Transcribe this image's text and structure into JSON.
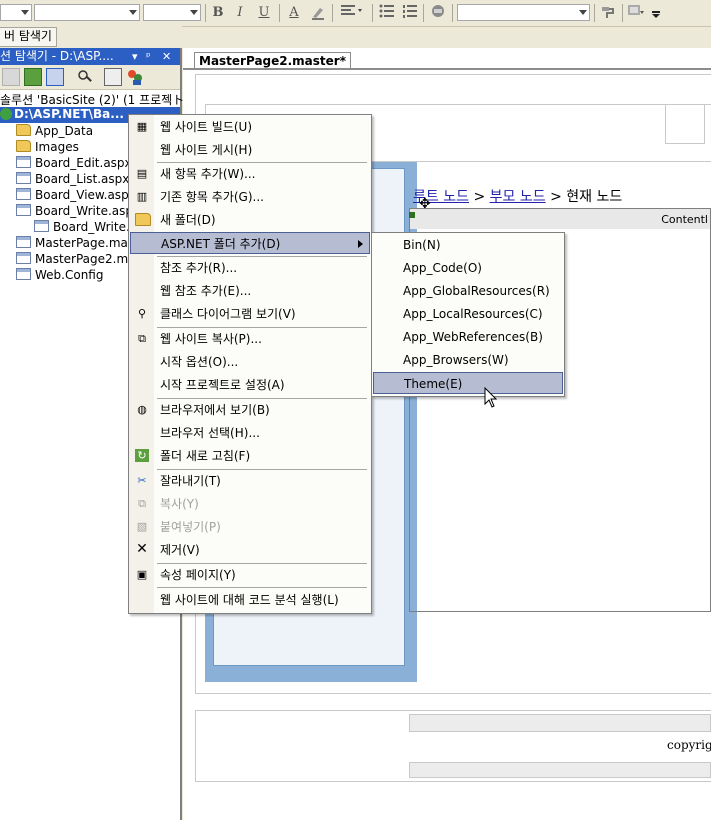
{
  "toolbar": {
    "bold": "B",
    "italic": "I",
    "underline": "U",
    "forecolor": "A"
  },
  "row2": {
    "tab_label": "버 탐색기"
  },
  "solution_explorer": {
    "title": "션 탐색기 - D:\\ASP....",
    "title_controls": [
      "▾",
      "ᵖ",
      "✕"
    ],
    "solution_line": "솔루션 'BasicSite (2)' (1 프로젝ト",
    "project_line": "D:\\ASP.NET\\Ba...",
    "items": [
      {
        "label": "App_Data",
        "icon": "folder"
      },
      {
        "label": "Images",
        "icon": "folder"
      },
      {
        "label": "Board_Edit.aspx",
        "icon": "page"
      },
      {
        "label": "Board_List.aspx",
        "icon": "page"
      },
      {
        "label": "Board_View.asp",
        "icon": "page"
      },
      {
        "label": "Board_Write.asp",
        "icon": "page"
      },
      {
        "label": "Board_Write.a",
        "icon": "page"
      },
      {
        "label": "MasterPage.mas",
        "icon": "page"
      },
      {
        "label": "MasterPage2.ma",
        "icon": "page"
      },
      {
        "label": "Web.Config",
        "icon": "page"
      }
    ]
  },
  "document": {
    "tab_label": "MasterPage2.master*",
    "sitemap": {
      "root": "루트 노드",
      "sep1": ">",
      "parent": "부모 노드",
      "sep2": ">",
      "current": "현재 노드"
    },
    "content_label": "Contentl",
    "footer_text": "copyrig"
  },
  "context_menu": {
    "items": [
      {
        "label": "웹 사이트 빌드(U)",
        "icon": "build-icon"
      },
      {
        "label": "웹 사이트 게시(H)",
        "icon": ""
      },
      {
        "label": "새 항목 추가(W)...",
        "icon": "add-new-item-icon"
      },
      {
        "label": "기존 항목 추가(G)...",
        "icon": "add-existing-item-icon"
      },
      {
        "label": "새 폴더(D)",
        "icon": "new-folder-icon"
      },
      {
        "label": "ASP.NET 폴더 추가(D)",
        "icon": ""
      },
      {
        "label": "참조 추가(R)...",
        "icon": ""
      },
      {
        "label": "웹 참조 추가(E)...",
        "icon": ""
      },
      {
        "label": "클래스 다이어그램 보기(V)",
        "icon": "class-diagram-icon"
      },
      {
        "label": "웹 사이트 복사(P)...",
        "icon": "copy-website-icon"
      },
      {
        "label": "시작 옵션(O)...",
        "icon": ""
      },
      {
        "label": "시작 프로젝트로 설정(A)",
        "icon": ""
      },
      {
        "label": "브라우저에서 보기(B)",
        "icon": "view-in-browser-icon"
      },
      {
        "label": "브라우저 선택(H)...",
        "icon": ""
      },
      {
        "label": "폴더 새로 고침(F)",
        "icon": "refresh-icon"
      },
      {
        "label": "잘라내기(T)",
        "icon": "cut-icon"
      },
      {
        "label": "복사(Y)",
        "icon": "copy-icon"
      },
      {
        "label": "붙여넣기(P)",
        "icon": "paste-icon"
      },
      {
        "label": "제거(V)",
        "icon": "remove-icon"
      },
      {
        "label": "속성 페이지(Y)",
        "icon": "property-pages-icon"
      },
      {
        "label": "웹 사이트에 대해 코드 분석 실행(L)",
        "icon": ""
      }
    ]
  },
  "submenu": {
    "items": [
      "Bin(N)",
      "App_Code(O)",
      "App_GlobalResources(R)",
      "App_LocalResources(C)",
      "App_WebReferences(B)",
      "App_Browsers(W)",
      "Theme(E)"
    ]
  }
}
